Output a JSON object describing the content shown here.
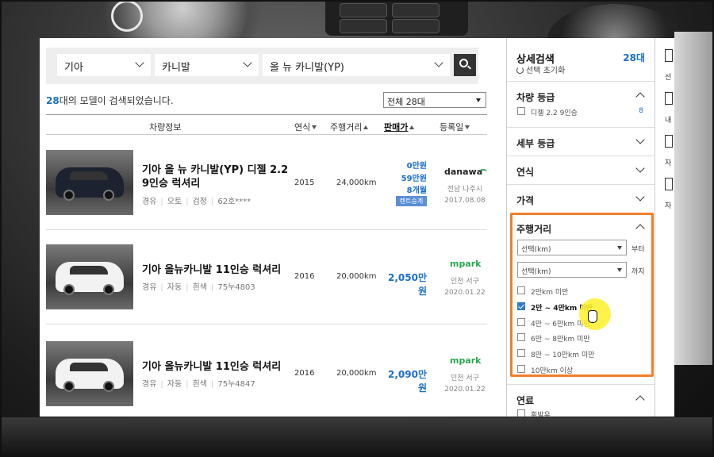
{
  "filters": {
    "maker": "기아",
    "model": "카니발",
    "submodel": "올 뉴 카니발(YP)"
  },
  "result": {
    "count": "28",
    "suffix": "대의 모델이 검색되었습니다.",
    "sort_option": "전체 28대"
  },
  "table_headers": {
    "info": "차량정보",
    "year": "연식",
    "mileage": "주행거리",
    "price": "판매가",
    "registered": "등록일"
  },
  "listings": [
    {
      "title": "기아 올 뉴 카니발(YP) 디젤 2.2 9인승 럭셔리",
      "fuel": "경유",
      "trans": "오토",
      "color": "검정",
      "plate": "62호****",
      "year": "2015",
      "km": "24,000km",
      "price_line1": "0만원",
      "price_line2": "59만원",
      "price_line3": "8개월",
      "badge": "렌트승계",
      "dealer": "danawa",
      "location": "전남 나주시",
      "date": "2017.08.08",
      "car_color": "#1d2230"
    },
    {
      "title": "기아 올뉴카니발 11인승 럭셔리",
      "fuel": "경유",
      "trans": "자동",
      "color": "흰색",
      "plate": "75누4803",
      "year": "2016",
      "km": "20,000km",
      "price": "2,050만원",
      "dealer": "mpark",
      "location": "인천 서구",
      "date": "2020.01.22",
      "car_color": "#f2f2f2"
    },
    {
      "title": "기아 올뉴카니발 11인승 럭셔리",
      "fuel": "경유",
      "trans": "자동",
      "color": "흰색",
      "plate": "75누4847",
      "year": "2016",
      "km": "20,000km",
      "price": "2,090만원",
      "dealer": "mpark",
      "location": "인천 서구",
      "date": "2020.01.22",
      "car_color": "#f2f2f2"
    }
  ],
  "sidebar": {
    "title": "상세검색",
    "count": "28대",
    "reset": "선택 초기화",
    "grade": {
      "title": "차량 등급",
      "option": "디젤 2.2 9인승",
      "count": "8"
    },
    "subgrade": "세부 등급",
    "year": "연식",
    "price": "가격",
    "mileage": {
      "title": "주행거리",
      "select_placeholder": "선택(km)",
      "from_label": "부터",
      "to_label": "까지",
      "options": [
        "2만km 미만",
        "2만 ~ 4만km 미만",
        "4만 ~ 6만km 미만",
        "6만 ~ 8만km 미만",
        "8만 ~ 10만km 미만",
        "10만km 이상"
      ],
      "checked_index": 1
    },
    "fuel": {
      "title": "연료",
      "option": "휘발유"
    }
  },
  "right_strip": [
    "선",
    "내",
    "자",
    "자"
  ],
  "colors": {
    "accent": "#1b6fc8",
    "highlight": "#f07f2a",
    "mpark": "#2aa652"
  }
}
